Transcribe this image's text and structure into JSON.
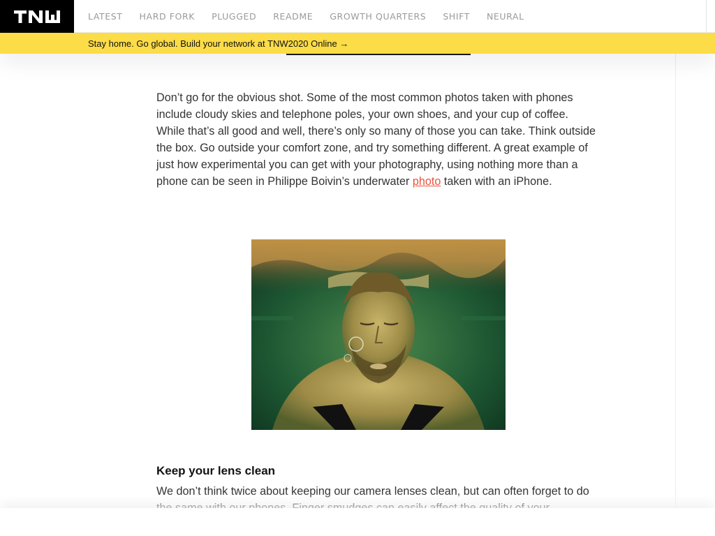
{
  "header": {
    "logo_alt": "TNW",
    "nav": [
      {
        "label": "LATEST"
      },
      {
        "label": "HARD FORK"
      },
      {
        "label": "PLUGGED"
      },
      {
        "label": "README"
      },
      {
        "label": "GROWTH QUARTERS"
      },
      {
        "label": "SHIFT"
      },
      {
        "label": "NEURAL"
      }
    ]
  },
  "promo": {
    "text": "Stay home. Go global. Build your network at TNW2020 Online →",
    "color": "#fcdc47"
  },
  "article": {
    "paragraph1_before": "Don’t go for the obvious shot. Some of the most common photos taken with phones include cloudy skies and telephone poles, your own shoes, and your cup of coffee. While that’s all good and well, there’s only so many of those you can take. Think outside the box. Go outside your comfort zone, and try something different. A great example of just how experimental you can get with your photography, using nothing more than a phone can be seen in Philippe Boivin’s underwater ",
    "paragraph1_link": "photo",
    "paragraph1_after": " taken with an iPhone.",
    "image_alt": "Man underwater in a pool",
    "heading": "Keep your lens clean",
    "paragraph2": "We don’t think twice about keeping our camera lenses clean, but can often forget to do the same with our phones. Finger smudges can easily affect the quality of your"
  },
  "colors": {
    "link": "#e8543a",
    "nav_text": "#9a9a9a",
    "logo_bg": "#000000"
  }
}
